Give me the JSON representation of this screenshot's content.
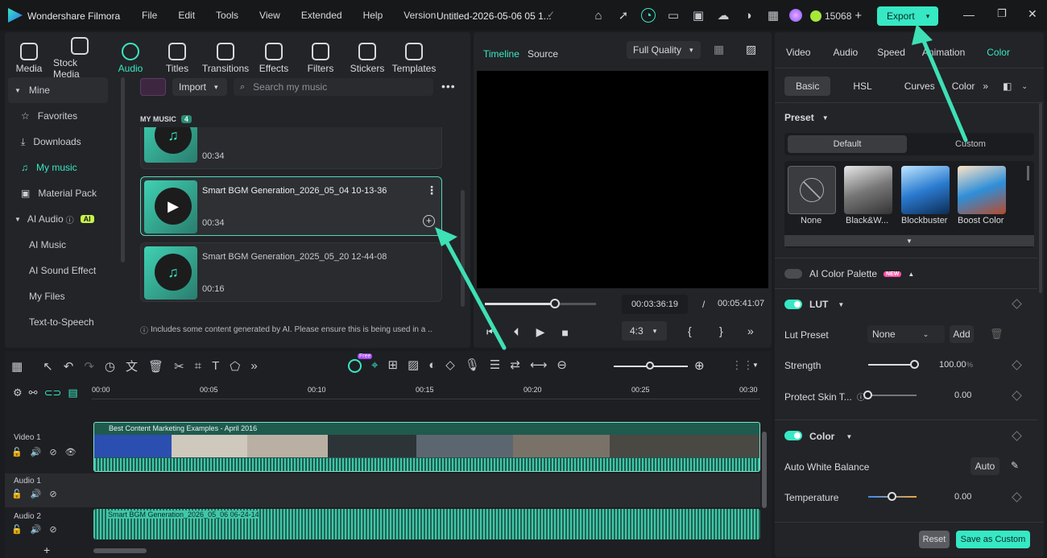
{
  "app": {
    "name": "Wondershare Filmora",
    "menu": [
      "File",
      "Edit",
      "Tools",
      "View",
      "Extended",
      "Help",
      "Version"
    ],
    "project_title": "Untitled-2026-05-06 05 1...",
    "credits": "15068",
    "export_label": "Export"
  },
  "toolbar": {
    "items": [
      "Media",
      "Stock Media",
      "Audio",
      "Titles",
      "Transitions",
      "Effects",
      "Filters",
      "Stickers",
      "Templates"
    ]
  },
  "sidebar": {
    "mine": "Mine",
    "favorites": "Favorites",
    "downloads": "Downloads",
    "my_music": "My music",
    "material_pack": "Material Pack",
    "ai_audio": "AI Audio",
    "ai_badge": "AI",
    "ai_music": "AI Music",
    "ai_sound_effect": "AI Sound Effect",
    "my_files": "My Files",
    "text_to_speech": "Text-to-Speech"
  },
  "library": {
    "import_label": "Import",
    "search_placeholder": "Search my music",
    "section_label": "MY MUSIC",
    "count": "4",
    "notice": "Includes some content generated by AI. Please ensure this is being used in a ..",
    "items": [
      {
        "name": "",
        "duration": "00:34"
      },
      {
        "name": "Smart BGM Generation_2026_05_04 10-13-36",
        "duration": "00:34"
      },
      {
        "name": "Smart BGM Generation_2025_05_20 12-44-08",
        "duration": "00:16"
      }
    ]
  },
  "preview": {
    "tab_timeline": "Timeline",
    "tab_source": "Source",
    "quality": "Full Quality",
    "current_time": "00:03:36:19",
    "separator": "/",
    "total_time": "00:05:41:07",
    "ratio": "4:3"
  },
  "timeline": {
    "free_badge": "Free",
    "ruler": [
      "00:00",
      "00:05",
      "00:10",
      "00:15",
      "00:20",
      "00:25",
      "00:30"
    ],
    "video_track": "Video 1",
    "audio1_track": "Audio 1",
    "audio2_track": "Audio 2",
    "video_clip": "Best Content Marketing Examples - April 2016",
    "audio_clip": "Smart BGM Generation_2026_05_06 06-24-14"
  },
  "right": {
    "tabs": [
      "Video",
      "Audio",
      "Speed",
      "Animation",
      "Color"
    ],
    "subtabs": [
      "Basic",
      "HSL",
      "Curves",
      "Color"
    ],
    "preset_label": "Preset",
    "preset_default": "Default",
    "preset_custom": "Custom",
    "presets": [
      "None",
      "Black&W...",
      "Blockbuster",
      "Boost Color"
    ],
    "ai_palette": "AI Color Palette",
    "new_badge": "NEW",
    "lut": "LUT",
    "lut_preset_label": "Lut Preset",
    "lut_preset_value": "None",
    "add": "Add",
    "strength": "Strength",
    "strength_value": "100.00",
    "strength_unit": "%",
    "protect_skin": "Protect Skin T...",
    "protect_value": "0.00",
    "color": "Color",
    "auto_wb": "Auto White Balance",
    "auto": "Auto",
    "temperature": "Temperature",
    "temperature_value": "0.00",
    "reset": "Reset",
    "save_custom": "Save as Custom"
  },
  "colors": {
    "accent": "#36e8c4",
    "arrow": "#3ee0b6",
    "panel": "#232427",
    "bg": "#17181a"
  },
  "progress": {
    "playhead_fraction": 0.63,
    "strength_fraction": 1.0,
    "protect_fraction": 0.0,
    "temperature_fraction": 0.5
  }
}
